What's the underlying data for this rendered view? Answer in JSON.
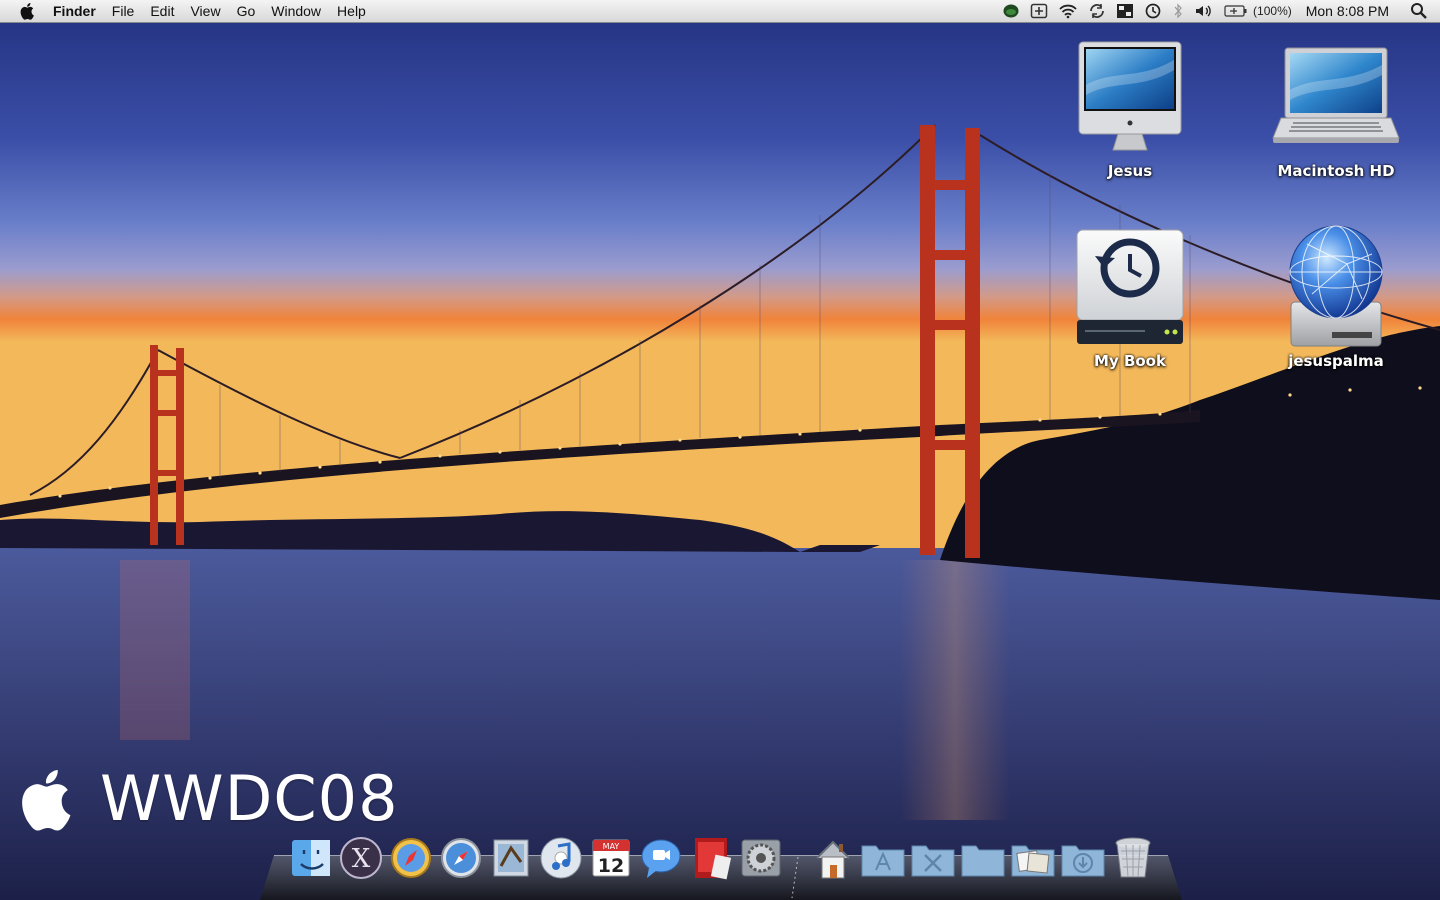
{
  "menubar": {
    "apple_icon": "apple-icon",
    "app_name": "Finder",
    "menus": [
      "File",
      "Edit",
      "View",
      "Go",
      "Window",
      "Help"
    ],
    "status_icons": [
      "growl-icon",
      "add-icon",
      "wifi-icon",
      "sync-icon",
      "spaces-icon",
      "time-machine-icon",
      "bluetooth-icon",
      "volume-icon",
      "battery-icon"
    ],
    "battery_percent": "(100%)",
    "clock": "Mon 8:08 PM",
    "spotlight_icon": "spotlight-icon"
  },
  "desktop": {
    "icons": [
      {
        "label": "Jesus",
        "icon": "imac-icon"
      },
      {
        "label": "Macintosh HD",
        "icon": "macbook-icon"
      },
      {
        "label": "My Book",
        "icon": "time-machine-drive-icon"
      },
      {
        "label": "jesuspalma",
        "icon": "network-disk-icon"
      }
    ]
  },
  "wallpaper": {
    "logo_text": "WWDC08",
    "logo_icon": "apple-logo-icon"
  },
  "dock": {
    "apps": [
      "finder-icon",
      "osx-icon",
      "safari-icon",
      "safari-alt-icon",
      "mail-icon",
      "itunes-icon",
      "ical-icon",
      "ichat-icon",
      "photo-booth-icon",
      "system-preferences-icon"
    ],
    "calendar_month": "MAY",
    "calendar_day": "12",
    "folders": [
      "home-icon",
      "applications-folder-icon",
      "utilities-folder-icon",
      "documents-folder-icon",
      "stack-folder-icon",
      "downloads-folder-icon",
      "trash-icon"
    ]
  }
}
